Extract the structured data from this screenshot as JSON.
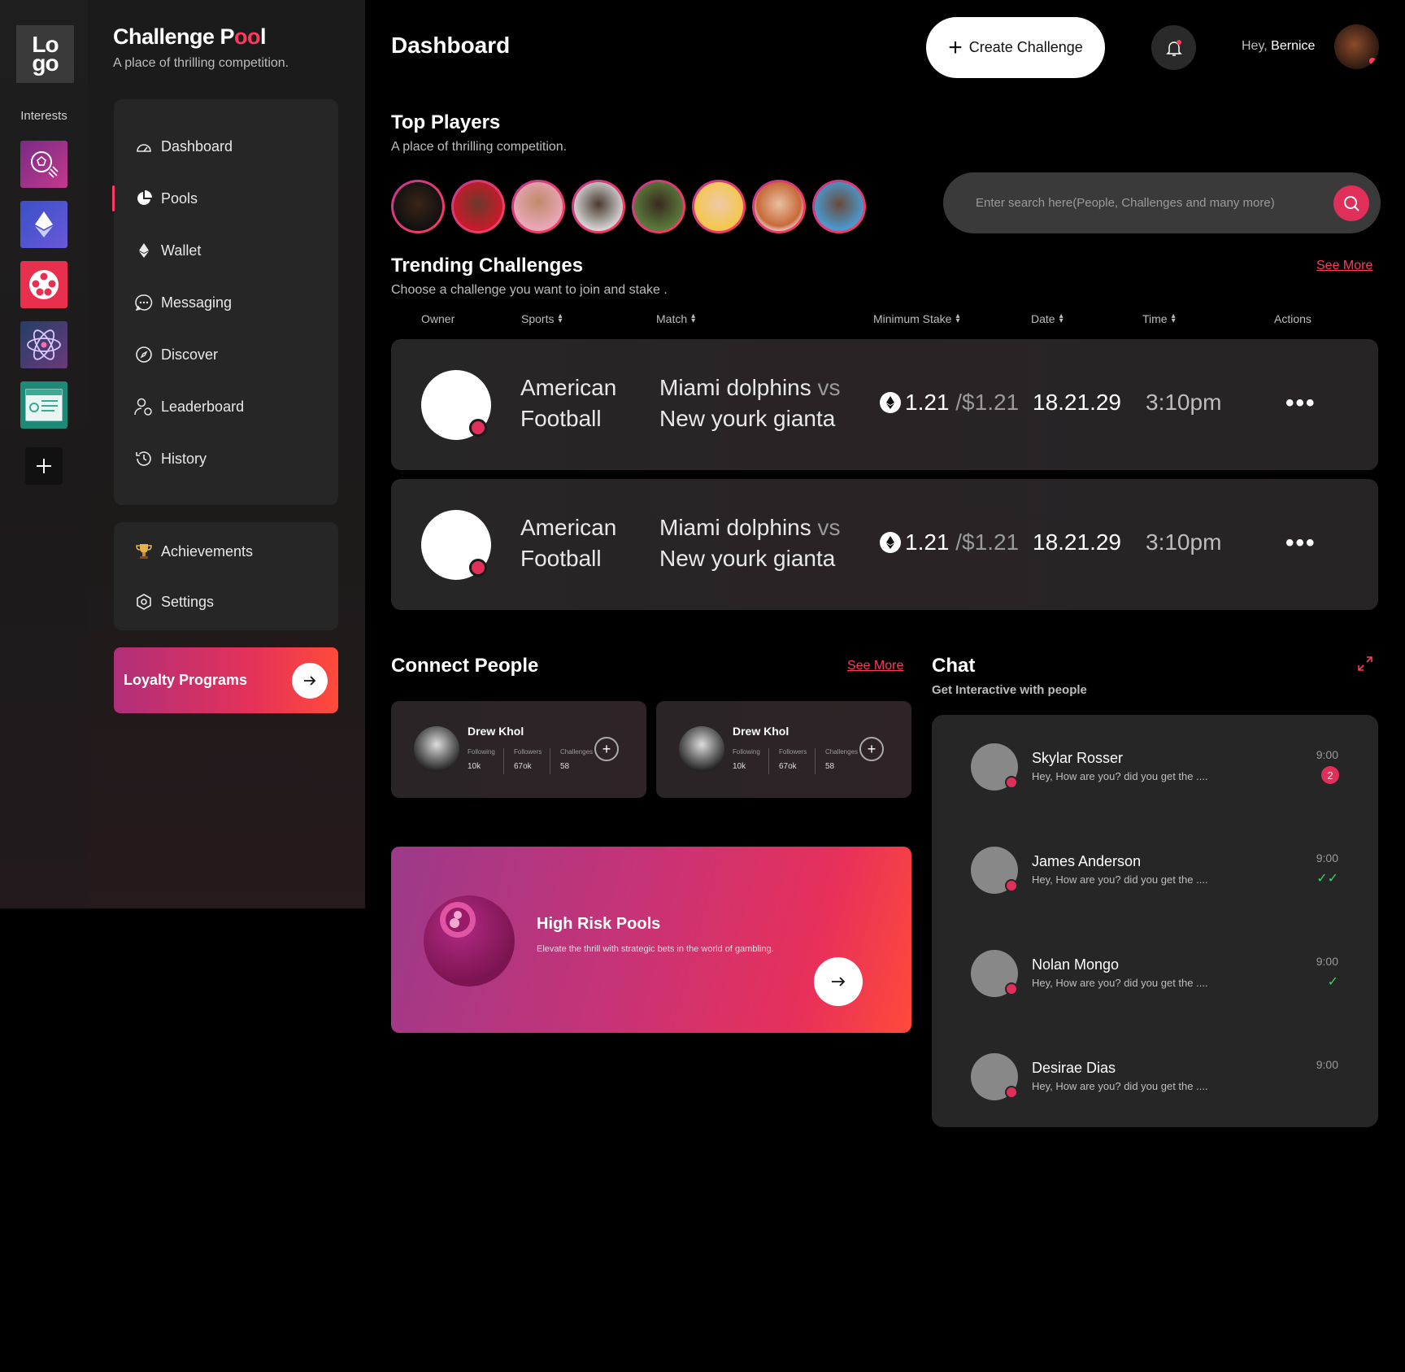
{
  "rail": {
    "logo_line1": "Lo",
    "logo_line2": "go",
    "label": "Interests",
    "tiles": [
      "soccer-ball-icon",
      "ethereum-icon",
      "film-reel-icon",
      "atom-icon",
      "certificate-icon",
      "plus-icon"
    ]
  },
  "brand": {
    "title_a": "Challenge P",
    "title_b": "oo",
    "title_c": "l",
    "subtitle": "A place of thrilling competition."
  },
  "nav": {
    "items": [
      {
        "label": "Dashboard",
        "icon": "gauge-icon"
      },
      {
        "label": "Pools",
        "icon": "pie-chart-icon"
      },
      {
        "label": "Wallet",
        "icon": "ethereum-icon"
      },
      {
        "label": "Messaging",
        "icon": "chat-bubble-icon"
      },
      {
        "label": "Discover",
        "icon": "compass-icon"
      },
      {
        "label": "Leaderboard",
        "icon": "user-rank-icon"
      },
      {
        "label": "History",
        "icon": "history-icon"
      }
    ],
    "secondary": [
      {
        "label": "Achievements",
        "icon": "trophy-icon"
      },
      {
        "label": "Settings",
        "icon": "settings-icon"
      }
    ],
    "active": "Pools",
    "loyalty_label": "Loyalty Programs"
  },
  "header": {
    "title": "Dashboard",
    "create_label": "Create Challenge",
    "greeting": "Hey,",
    "user_name": "Bernice"
  },
  "top_players": {
    "title": "Top Players",
    "subtitle": "A place of thrilling competition.",
    "count": 8
  },
  "search": {
    "placeholder": "Enter search here(People, Challenges and many more)"
  },
  "trending": {
    "title": "Trending Challenges",
    "subtitle": "Choose a challenge you want to join and stake .",
    "see_more": "See More",
    "columns": [
      "Owner",
      "Sports",
      "Match",
      "Minimum Stake",
      "Date",
      "Time",
      "Actions"
    ],
    "rows": [
      {
        "sport_1": "American",
        "sport_2": "Football",
        "team_a": "Miami dolphins",
        "vs": "vs",
        "team_b": "New yourk gianta",
        "stake": "1.21",
        "stake_usd": "/$1.21",
        "date": "18.21.29",
        "time": "3:10pm",
        "actions": "•••"
      },
      {
        "sport_1": "American",
        "sport_2": "Football",
        "team_a": "Miami dolphins",
        "vs": "vs",
        "team_b": "New yourk gianta",
        "stake": "1.21",
        "stake_usd": "/$1.21",
        "date": "18.21.29",
        "time": "3:10pm",
        "actions": "•••"
      }
    ]
  },
  "connect": {
    "title": "Connect People",
    "see_more": "See More",
    "people": [
      {
        "name": "Drew Khol",
        "l1": "Following",
        "l2": "Followers",
        "l3": "Challenges",
        "v1": "10k",
        "v2": "67ok",
        "v3": "58"
      },
      {
        "name": "Drew Khol",
        "l1": "Following",
        "l2": "Followers",
        "l3": "Challenges",
        "v1": "10k",
        "v2": "67ok",
        "v3": "58"
      }
    ]
  },
  "high_risk": {
    "title": "High Risk Pools",
    "desc": "Elevate the thrill with strategic bets in the world of gambling."
  },
  "chat": {
    "title": "Chat",
    "subtitle": "Get Interactive with people",
    "items": [
      {
        "name": "Skylar Rosser",
        "msg": "Hey, How are you? did you get the ....",
        "time": "9:00",
        "badge": "2",
        "status": ""
      },
      {
        "name": "James Anderson",
        "msg": "Hey, How are you? did you get the ....",
        "time": "9:00",
        "badge": "",
        "status": "✓✓"
      },
      {
        "name": "Nolan Mongo",
        "msg": "Hey, How are you? did you get the ....",
        "time": "9:00",
        "badge": "",
        "status": "✓"
      },
      {
        "name": "Desirae Dias",
        "msg": "Hey, How are you? did you get the ....",
        "time": "9:00",
        "badge": "",
        "status": ""
      }
    ]
  },
  "colors": {
    "accent": "#ff3a5e",
    "bg": "#000000",
    "panel": "#262626"
  }
}
